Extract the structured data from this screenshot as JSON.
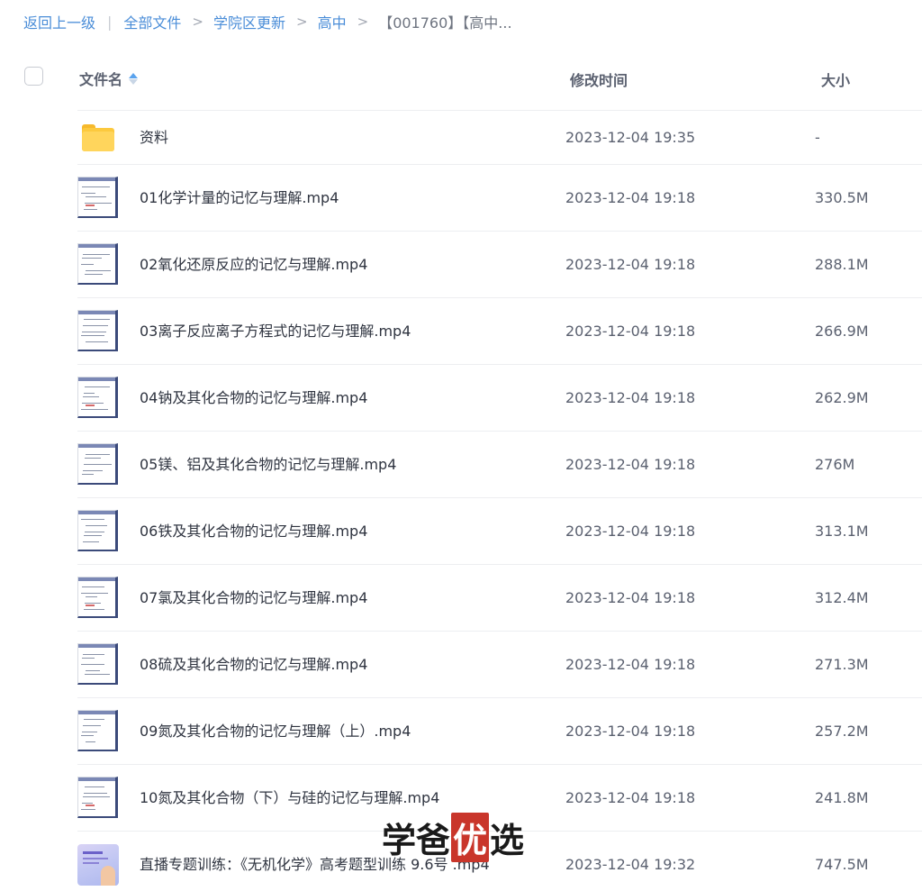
{
  "breadcrumb": {
    "back": "返回上一级",
    "items": [
      "全部文件",
      "学院区更新",
      "高中",
      "【001760】【高中..."
    ]
  },
  "header": {
    "name_label": "文件名",
    "time_label": "修改时间",
    "size_label": "大小"
  },
  "files": [
    {
      "name": "资料",
      "time": "2023-12-04 19:35",
      "size": "-",
      "kind": "folder"
    },
    {
      "name": "01化学计量的记忆与理解.mp4",
      "time": "2023-12-04 19:18",
      "size": "330.5M",
      "kind": "video"
    },
    {
      "name": "02氧化还原反应的记忆与理解.mp4",
      "time": "2023-12-04 19:18",
      "size": "288.1M",
      "kind": "video"
    },
    {
      "name": "03离子反应离子方程式的记忆与理解.mp4",
      "time": "2023-12-04 19:18",
      "size": "266.9M",
      "kind": "video"
    },
    {
      "name": "04钠及其化合物的记忆与理解.mp4",
      "time": "2023-12-04 19:18",
      "size": "262.9M",
      "kind": "video"
    },
    {
      "name": "05镁、铝及其化合物的记忆与理解.mp4",
      "time": "2023-12-04 19:18",
      "size": "276M",
      "kind": "video"
    },
    {
      "name": "06铁及其化合物的记忆与理解.mp4",
      "time": "2023-12-04 19:18",
      "size": "313.1M",
      "kind": "video"
    },
    {
      "name": "07氯及其化合物的记忆与理解.mp4",
      "time": "2023-12-04 19:18",
      "size": "312.4M",
      "kind": "video"
    },
    {
      "name": "08硫及其化合物的记忆与理解.mp4",
      "time": "2023-12-04 19:18",
      "size": "271.3M",
      "kind": "video"
    },
    {
      "name": "09氮及其化合物的记忆与理解（上）.mp4",
      "time": "2023-12-04 19:18",
      "size": "257.2M",
      "kind": "video"
    },
    {
      "name": "10氮及其化合物（下）与硅的记忆与理解.mp4",
      "time": "2023-12-04 19:18",
      "size": "241.8M",
      "kind": "video"
    },
    {
      "name": "直播专题训练：《无机化学》高考题型训练 9.6号 .mp4",
      "time": "2023-12-04 19:32",
      "size": "747.5M",
      "kind": "live"
    }
  ],
  "watermark": {
    "left": "学爸",
    "highlight": "优",
    "right": "选"
  },
  "colors": {
    "link": "#4a8dd8",
    "sort_active": "#5aa3ee",
    "folder": "#fcc93e",
    "watermark_red": "#c9362b"
  }
}
